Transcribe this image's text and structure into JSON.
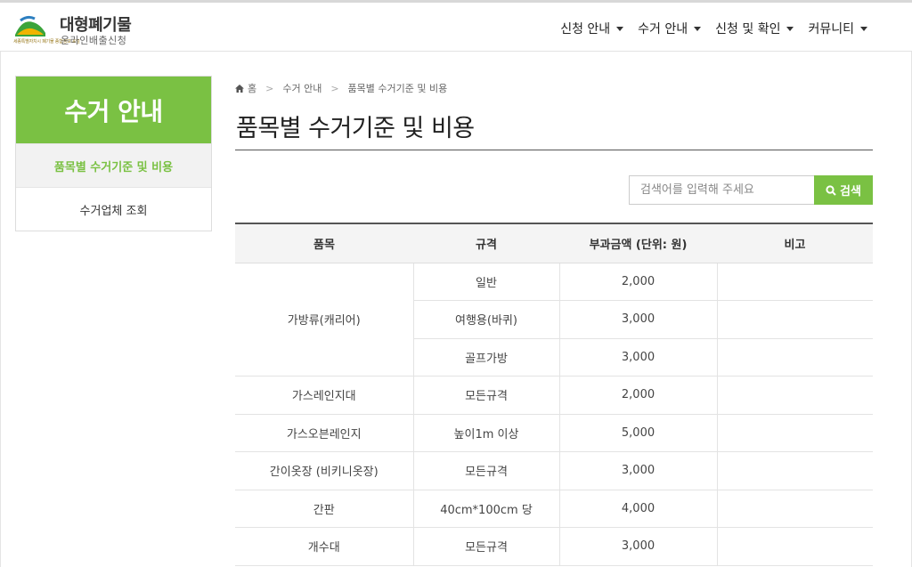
{
  "header": {
    "logo_small": "세종특별자치시 폐기물 종합정보 포털",
    "logo_title": "대형폐기물",
    "logo_subtitle": "온라인배출신청",
    "nav": [
      {
        "label": "신청 안내"
      },
      {
        "label": "수거 안내"
      },
      {
        "label": "신청 및 확인"
      },
      {
        "label": "커뮤니티"
      }
    ]
  },
  "sidebar": {
    "title": "수거 안내",
    "items": [
      {
        "label": "품목별 수거기준 및 비용",
        "active": true
      },
      {
        "label": "수거업체 조회",
        "active": false
      }
    ]
  },
  "breadcrumb": {
    "home": "홈",
    "level1": "수거 안내",
    "level2": "품목별 수거기준 및 비용"
  },
  "page_title": "품목별 수거기준 및 비용",
  "search": {
    "placeholder": "검색어를 입력해 주세요",
    "button_label": "검색"
  },
  "table": {
    "headers": [
      "품목",
      "규격",
      "부과금액 (단위: 원)",
      "비고"
    ],
    "rows": [
      {
        "item": "가방류(캐리어)",
        "spec": "일반",
        "fee": "2,000",
        "note": ""
      },
      {
        "item": "",
        "spec": "여행용(바퀴)",
        "fee": "3,000",
        "note": ""
      },
      {
        "item": "",
        "spec": "골프가방",
        "fee": "3,000",
        "note": ""
      },
      {
        "item": "가스레인지대",
        "spec": "모든규격",
        "fee": "2,000",
        "note": ""
      },
      {
        "item": "가스오븐레인지",
        "spec": "높이1m 이상",
        "fee": "5,000",
        "note": ""
      },
      {
        "item": "간이옷장 (비키니옷장)",
        "spec": "모든규격",
        "fee": "3,000",
        "note": ""
      },
      {
        "item": "간판",
        "spec": "40cm*100cm 당",
        "fee": "4,000",
        "note": ""
      },
      {
        "item": "개수대",
        "spec": "모든규격",
        "fee": "3,000",
        "note": ""
      }
    ]
  },
  "colors": {
    "accent": "#7ac143",
    "header_bg": "#f4f4f4"
  }
}
